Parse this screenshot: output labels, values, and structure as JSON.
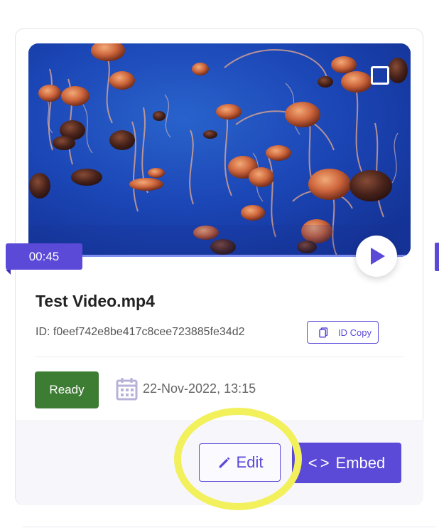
{
  "card": {
    "duration": "00:45",
    "title": "Test Video.mp4",
    "id_line": "ID: f0eef742e8be417c8cee723885fe34d2",
    "id_copy_label": "ID Copy",
    "status": "Ready",
    "date": "22-Nov-2022, 13:15",
    "actions": {
      "edit": "Edit",
      "embed": "Embed"
    }
  },
  "icons": {
    "copy": "copy-icon",
    "calendar": "calendar-icon",
    "edit": "pencil-icon",
    "embed": "code-brackets-icon",
    "play": "play-icon",
    "select": "select-checkbox-icon"
  },
  "colors": {
    "accent": "#5b4ad8",
    "ready": "#3d7c33",
    "highlight": "#f2f05b"
  }
}
